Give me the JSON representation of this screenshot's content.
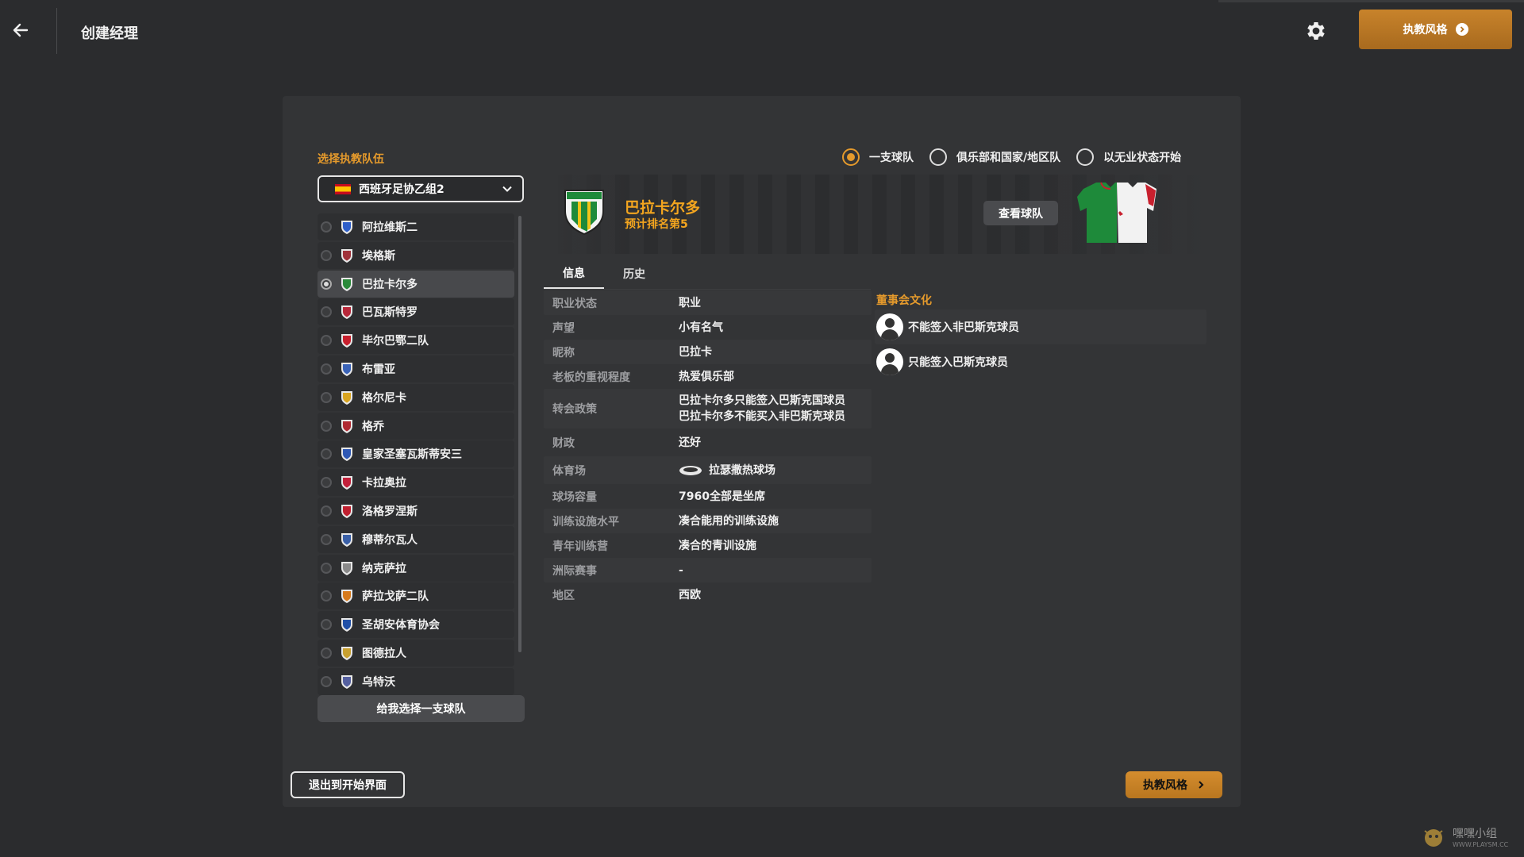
{
  "header": {
    "title": "创建经理",
    "top_style_button": "执教风格"
  },
  "team_select": {
    "label": "选择执教队伍",
    "league": "西班牙足协乙组2",
    "teams": [
      {
        "name": "阿拉维斯二",
        "crest": "#2f5fc9"
      },
      {
        "name": "埃格斯",
        "crest": "#a0323a"
      },
      {
        "name": "巴拉卡尔多",
        "crest": "#2a8a3a"
      },
      {
        "name": "巴瓦斯特罗",
        "crest": "#b8283a"
      },
      {
        "name": "毕尔巴鄂二队",
        "crest": "#c8202e"
      },
      {
        "name": "布雷亚",
        "crest": "#3a63b8"
      },
      {
        "name": "格尔尼卡",
        "crest": "#d9a520"
      },
      {
        "name": "格乔",
        "crest": "#b02a32"
      },
      {
        "name": "皇家圣塞瓦斯蒂安三",
        "crest": "#2e58b5"
      },
      {
        "name": "卡拉奥拉",
        "crest": "#c3203a"
      },
      {
        "name": "洛格罗涅斯",
        "crest": "#c02030"
      },
      {
        "name": "穆蒂尔瓦人",
        "crest": "#3a60a8"
      },
      {
        "name": "纳克萨拉",
        "crest": "#8a8a8a"
      },
      {
        "name": "萨拉戈萨二队",
        "crest": "#d77a1c"
      },
      {
        "name": "圣胡安体育协会",
        "crest": "#2050a8"
      },
      {
        "name": "图德拉人",
        "crest": "#c8a030"
      },
      {
        "name": "乌特沃",
        "crest": "#5560a0"
      }
    ],
    "selected_index": 2,
    "random_button": "给我选择一支球队"
  },
  "modes": {
    "options": [
      "一支球队",
      "俱乐部和国家/地区队",
      "以无业状态开始"
    ],
    "selected_index": 0
  },
  "team": {
    "name": "巴拉卡尔多",
    "rank": "预计排名第5",
    "view_button": "查看球队",
    "colors": {
      "primary": "#1e8a3a",
      "secondary": "#f2f2f2",
      "accent": "#c8202e"
    }
  },
  "tabs": [
    "信息",
    "历史"
  ],
  "active_tab": 0,
  "info": {
    "career_status": {
      "k": "职业状态",
      "v": "职业"
    },
    "reputation": {
      "k": "声望",
      "v": "小有名气"
    },
    "nickname": {
      "k": "昵称",
      "v": "巴拉卡"
    },
    "board_importance": {
      "k": "老板的重视程度",
      "v": "热爱俱乐部"
    },
    "transfer_policy": {
      "k": "转会政策",
      "v1": "巴拉卡尔多只能签入巴斯克国球员",
      "v2": "巴拉卡尔多不能买入非巴斯克球员"
    },
    "finances": {
      "k": "财政",
      "v": "还好"
    },
    "stadium": {
      "k": "体育场",
      "v": "拉瑟撒热球场"
    },
    "capacity": {
      "k": "球场容量",
      "v": "7960全部是坐席"
    },
    "training": {
      "k": "训练设施水平",
      "v": "凑合能用的训练设施"
    },
    "youth": {
      "k": "青年训练营",
      "v": "凑合的青训设施"
    },
    "continental": {
      "k": "洲际赛事",
      "v": "-"
    },
    "region": {
      "k": "地区",
      "v": "西欧"
    }
  },
  "board_culture": {
    "title": "董事会文化",
    "items": [
      "不能签入非巴斯克球员",
      "只能签入巴斯克球员"
    ]
  },
  "footer": {
    "exit_button": "退出到开始界面",
    "style_button": "执教风格"
  },
  "watermark": {
    "text": "嘿嘿小组",
    "sub": "WWW.PLAYSM.CC"
  },
  "accent_color": "#e59a2c"
}
